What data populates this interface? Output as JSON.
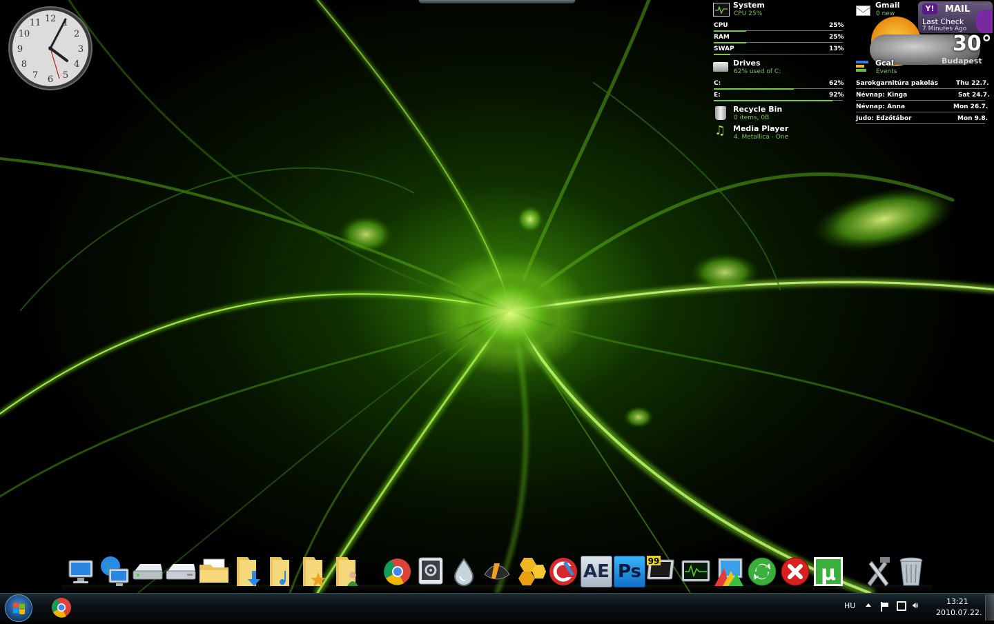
{
  "desktop": {
    "clock_numerals": [
      "12",
      "1",
      "2",
      "3",
      "4",
      "5",
      "6",
      "7",
      "8",
      "9",
      "10",
      "11"
    ]
  },
  "system_widget": {
    "title": "System",
    "subtitle": "CPU 25%",
    "rows": [
      {
        "label": "CPU",
        "value": "25%",
        "fraction": 0.25
      },
      {
        "label": "RAM",
        "value": "25%",
        "fraction": 0.25
      },
      {
        "label": "SWAP",
        "value": "13%",
        "fraction": 0.13
      }
    ]
  },
  "drives_widget": {
    "title": "Drives",
    "subtitle": "62% used of C:",
    "rows": [
      {
        "label": "C:",
        "value": "62%",
        "fraction": 0.62
      },
      {
        "label": "E:",
        "value": "92%",
        "fraction": 0.92
      }
    ]
  },
  "recycle_widget": {
    "title": "Recycle Bin",
    "subtitle": "0 items, 0B"
  },
  "media_widget": {
    "title": "Media Player",
    "subtitle": "4. Metallica - One"
  },
  "gmail_widget": {
    "title": "Gmail",
    "subtitle": "0 new"
  },
  "yahoo_widget": {
    "brand": "Y!",
    "label": "MAIL",
    "line1": "Last Check",
    "line2": "7 Minutes Ago"
  },
  "weather_widget": {
    "temperature": "30°",
    "city": "Budapest"
  },
  "gcal_widget": {
    "title": "Gcal",
    "subtitle": "Events",
    "events": [
      {
        "name": "Sarokgarnitúra pakolás",
        "date": "Thu 22.7."
      },
      {
        "name": "Névnap: Kinga",
        "date": "Sat 24.7."
      },
      {
        "name": "Névnap: Anna",
        "date": "Mon 26.7."
      },
      {
        "name": "Judo: Edzőtábor",
        "date": "Mon 9.8."
      }
    ]
  },
  "dock": {
    "icons": [
      {
        "name": "computer-icon"
      },
      {
        "name": "network-icon"
      },
      {
        "name": "drive-icon"
      },
      {
        "name": "drive2-icon"
      },
      {
        "name": "documents-folder-icon"
      },
      {
        "name": "downloads-folder-icon"
      },
      {
        "name": "music-folder-icon"
      },
      {
        "name": "favorites-folder-icon"
      },
      {
        "name": "user-folder-icon"
      },
      {
        "name": "chrome-icon"
      },
      {
        "name": "settings-icon"
      },
      {
        "name": "droplet-icon"
      },
      {
        "name": "winamp-icon"
      },
      {
        "name": "hex-app-icon"
      },
      {
        "name": "ccleaner-icon"
      },
      {
        "name": "after-effects-icon",
        "text": "AE"
      },
      {
        "name": "photoshop-icon",
        "text": "Ps"
      },
      {
        "name": "monitor-99-icon",
        "text": "99"
      },
      {
        "name": "activity-monitor-icon"
      },
      {
        "name": "palette-icon"
      },
      {
        "name": "sync-icon"
      },
      {
        "name": "close-app-icon"
      },
      {
        "name": "utorrent-icon",
        "text": "µ"
      },
      {
        "name": "tools-icon"
      },
      {
        "name": "trash-icon"
      }
    ]
  },
  "taskbar": {
    "language": "HU",
    "time": "13:21",
    "date": "2010.07.22."
  }
}
